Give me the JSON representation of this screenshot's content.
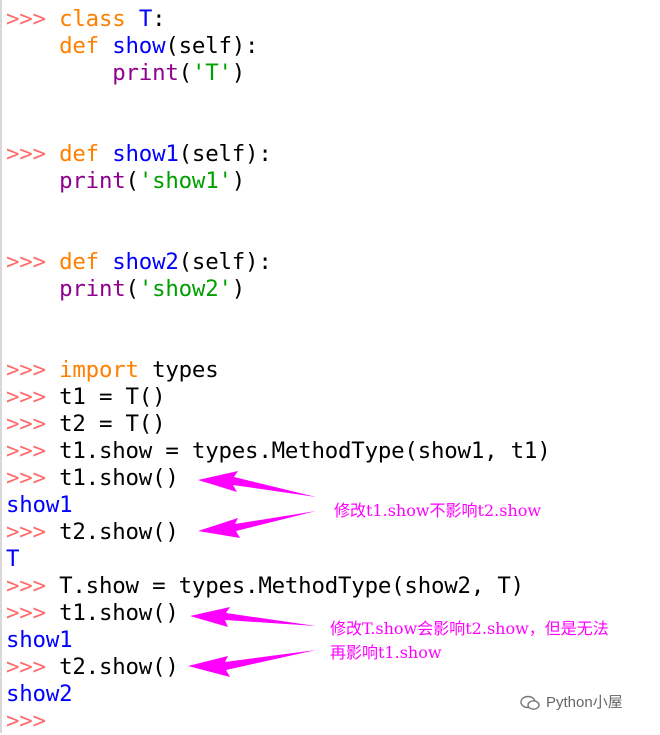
{
  "colors": {
    "prompt": "#ff6a6a",
    "keyword": "#ff7f00",
    "function": "#0000ff",
    "builtin": "#900090",
    "string": "#00a000",
    "output": "#0000ff",
    "annotation": "#ff00ff"
  },
  "prompt": ">>>",
  "lines": {
    "l1": {
      "kw": "class",
      "name": "T",
      "rest": ":"
    },
    "l2": {
      "kw": "def",
      "name": "show",
      "rest": "(self):"
    },
    "l3": {
      "call": "print",
      "open": "(",
      "str": "'T'",
      "close": ")"
    },
    "l4": {
      "kw": "def",
      "name": "show1",
      "rest": "(self):"
    },
    "l5": {
      "call": "print",
      "open": "(",
      "str": "'show1'",
      "close": ")"
    },
    "l6": {
      "kw": "def",
      "name": "show2",
      "rest": "(self):"
    },
    "l7": {
      "call": "print",
      "open": "(",
      "str": "'show2'",
      "close": ")"
    },
    "l8": {
      "kw": "import",
      "rest": "types"
    },
    "l9": "t1 = T()",
    "l10": "t2 = T()",
    "l11": "t1.show = types.MethodType(show1, t1)",
    "l12": "t1.show()",
    "o1": "show1",
    "l13": "t2.show()",
    "o2": "T",
    "l14": "T.show = types.MethodType(show2, T)",
    "l15": "t1.show()",
    "o3": "show1",
    "l16": "t2.show()",
    "o4": "show2"
  },
  "annotations": {
    "a1": "修改t1.show不影响t2.show",
    "a2_line1": "修改T.show会影响t2.show，但是无法",
    "a2_line2": "再影响t1.show"
  },
  "watermark": {
    "text": "Python小屋",
    "icon": "wechat-bubble-icon"
  }
}
